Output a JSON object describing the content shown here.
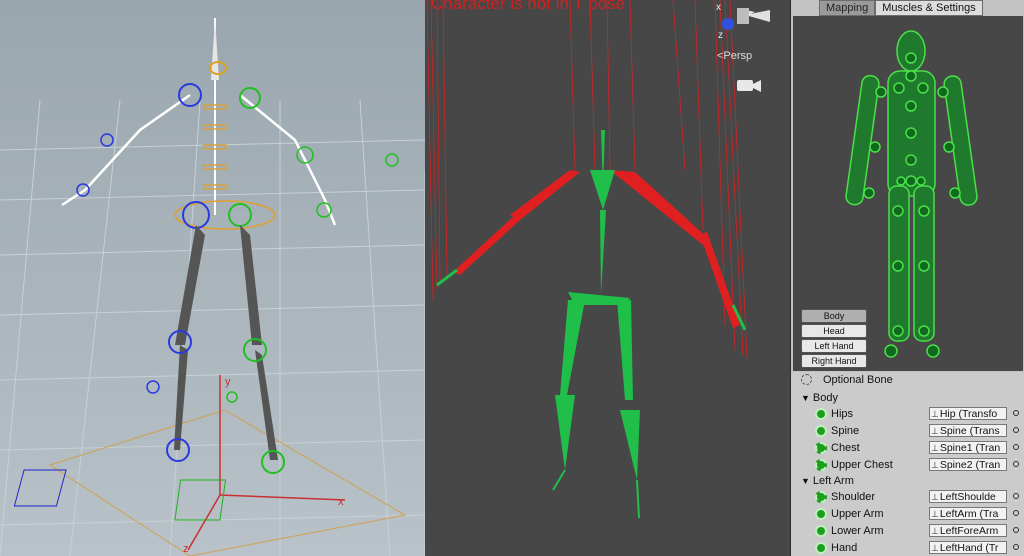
{
  "viewport_left": {
    "axis_x": "x",
    "axis_y": "y",
    "axis_z": "z"
  },
  "viewport_mid": {
    "warning": "Character is not in T pose",
    "gizmo_x": "x",
    "gizmo_z": "z",
    "projection": "<Persp"
  },
  "inspector": {
    "tabs": [
      "Mapping",
      "Muscles & Settings"
    ],
    "active_tab": "Mapping",
    "part_buttons": [
      "Body",
      "Head",
      "Left Hand",
      "Right Hand"
    ],
    "active_part": "Body",
    "optional_bone_label": "Optional Bone",
    "groups": [
      {
        "name": "Body",
        "bones": [
          {
            "name": "Hips",
            "transform": "Hip (Transfo",
            "optional": false
          },
          {
            "name": "Spine",
            "transform": "Spine (Trans",
            "optional": false
          },
          {
            "name": "Chest",
            "transform": "Spine1 (Tran",
            "optional": true
          },
          {
            "name": "Upper Chest",
            "transform": "Spine2 (Tran",
            "optional": true
          }
        ]
      },
      {
        "name": "Left Arm",
        "bones": [
          {
            "name": "Shoulder",
            "transform": "LeftShoulde",
            "optional": true
          },
          {
            "name": "Upper Arm",
            "transform": "LeftArm (Tra",
            "optional": false
          },
          {
            "name": "Lower Arm",
            "transform": "LeftForeArm",
            "optional": false
          },
          {
            "name": "Hand",
            "transform": "LeftHand (Tr",
            "optional": false
          }
        ]
      }
    ]
  },
  "colors": {
    "mapped_green": "#1fbf4a",
    "error_red": "#e02020",
    "left_bg": "#a8b4ba",
    "mid_bg": "#474747",
    "panel_bg": "#c2c2c2"
  }
}
